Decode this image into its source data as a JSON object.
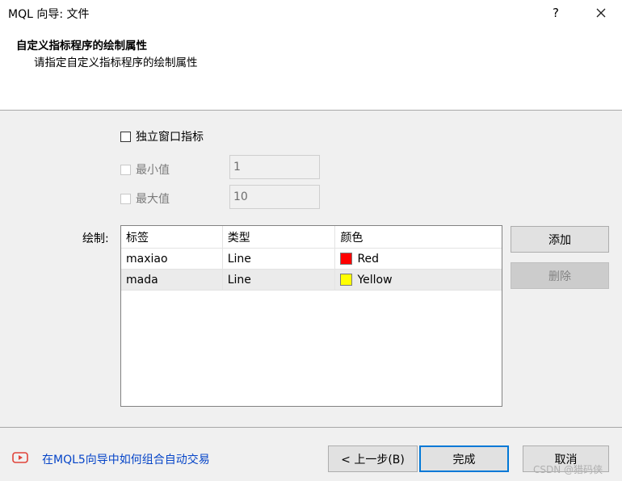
{
  "window": {
    "title": "MQL 向导: 文件",
    "help_glyph": "?"
  },
  "header": {
    "title": "自定义指标程序的绘制属性",
    "subtitle": "请指定自定义指标程序的绘制属性"
  },
  "options": {
    "separate_window_label": "独立窗口指标",
    "min_label": "最小值",
    "min_value": "1",
    "max_label": "最大值",
    "max_value": "10"
  },
  "plots": {
    "label": "绘制:",
    "columns": [
      "标签",
      "类型",
      "颜色"
    ],
    "rows": [
      {
        "label": "maxiao",
        "type": "Line",
        "color_name": "Red",
        "color_hex": "#ff0000"
      },
      {
        "label": "mada",
        "type": "Line",
        "color_name": "Yellow",
        "color_hex": "#ffff00"
      }
    ],
    "selected_row": 1
  },
  "buttons": {
    "add": "添加",
    "delete": "删除",
    "back": "< 上一步(B)",
    "finish": "完成",
    "cancel": "取消"
  },
  "footer": {
    "help_link": "在MQL5向导中如何组合自动交易",
    "watermark": "CSDN @猎码侠"
  },
  "colors": {
    "accent": "#0078d7",
    "link": "#0645c8",
    "video_icon": "#e0443a"
  },
  "icons": {
    "close": "close-icon",
    "video": "video-play-icon"
  }
}
